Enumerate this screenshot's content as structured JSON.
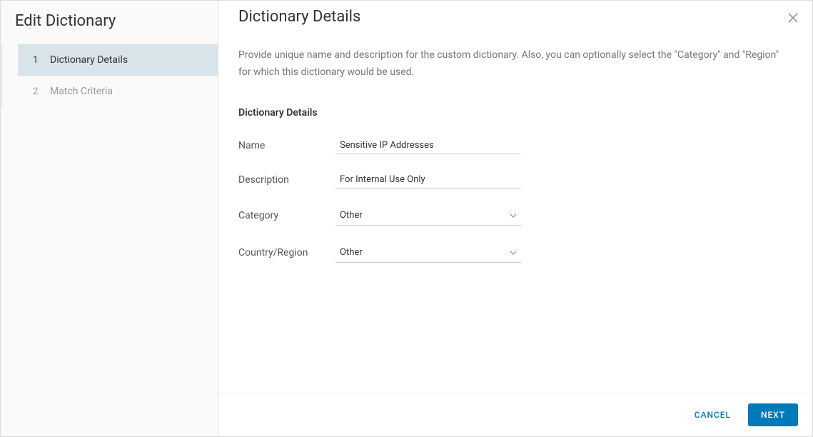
{
  "sidebar": {
    "title": "Edit Dictionary",
    "steps": [
      {
        "number": "1",
        "label": "Dictionary Details"
      },
      {
        "number": "2",
        "label": "Match Criteria"
      }
    ]
  },
  "main": {
    "title": "Dictionary Details",
    "help_text": "Provide unique name and description for the custom dictionary. Also, you can optionally select the \"Category\" and \"Region\" for which this dictionary would be used.",
    "section_heading": "Dictionary Details",
    "fields": {
      "name": {
        "label": "Name",
        "value": "Sensitive IP Addresses"
      },
      "description": {
        "label": "Description",
        "value": "For Internal Use Only"
      },
      "category": {
        "label": "Category",
        "value": "Other"
      },
      "region": {
        "label": "Country/Region",
        "value": "Other"
      }
    }
  },
  "footer": {
    "cancel": "CANCEL",
    "next": "NEXT"
  }
}
